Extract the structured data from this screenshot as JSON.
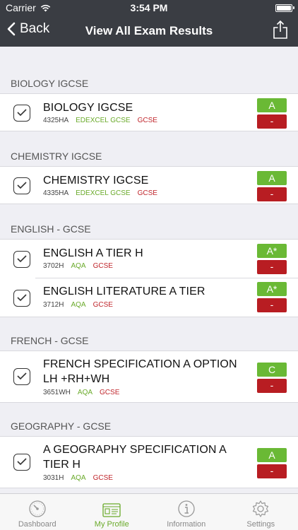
{
  "status": {
    "carrier": "Carrier",
    "time": "3:54 PM"
  },
  "nav": {
    "back_label": "Back",
    "title": "View All Exam Results"
  },
  "sections": [
    {
      "header": "BIOLOGY IGCSE",
      "items": [
        {
          "title": "BIOLOGY IGCSE",
          "code": "4325HA",
          "board": "EDEXCEL GCSE",
          "level": "GCSE",
          "grade": "A",
          "minus": "-"
        }
      ]
    },
    {
      "header": "CHEMISTRY IGCSE",
      "items": [
        {
          "title": "CHEMISTRY IGCSE",
          "code": "4335HA",
          "board": "EDEXCEL GCSE",
          "level": "GCSE",
          "grade": "A",
          "minus": "-"
        }
      ]
    },
    {
      "header": "ENGLISH - GCSE",
      "items": [
        {
          "title": "ENGLISH A TIER H",
          "code": "3702H",
          "board": "AQA",
          "level": "GCSE",
          "grade": "A*",
          "minus": "-"
        },
        {
          "title": "ENGLISH LITERATURE A TIER",
          "code": "3712H",
          "board": "AQA",
          "level": "GCSE",
          "grade": "A*",
          "minus": "-"
        }
      ]
    },
    {
      "header": "FRENCH - GCSE",
      "items": [
        {
          "title": "FRENCH SPECIFICATION A OPTION LH +RH+WH",
          "code": "3651WH",
          "board": "AQA",
          "level": "GCSE",
          "grade": "C",
          "minus": "-"
        }
      ]
    },
    {
      "header": "GEOGRAPHY - GCSE",
      "items": [
        {
          "title": "A GEOGRAPHY SPECIFICATION A TIER H",
          "code": "3031H",
          "board": "AQA",
          "level": "GCSE",
          "grade": "A",
          "minus": "-"
        }
      ]
    }
  ],
  "tabs": [
    {
      "label": "Dashboard",
      "icon": "speedometer-icon"
    },
    {
      "label": "My Profile",
      "icon": "profile-card-icon"
    },
    {
      "label": "Information",
      "icon": "info-icon"
    },
    {
      "label": "Settings",
      "icon": "gear-icon"
    }
  ],
  "colors": {
    "bar": "#3a3d43",
    "grade_green": "#6ab935",
    "minus_red": "#b81d22",
    "board_green": "#6aaa2a",
    "level_red": "#c0262c"
  }
}
